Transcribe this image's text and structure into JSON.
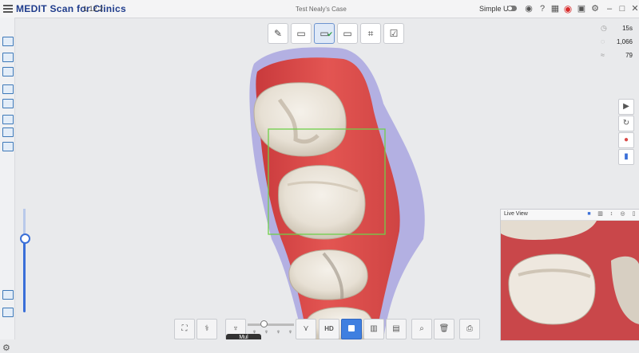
{
  "app": {
    "name_main": "MEDIT",
    "name_sub": "Scan for Clinics",
    "version": "1.12.2",
    "case_title": "Test Nealy's Case",
    "simple_ui_label": "Simple UI",
    "simple_ui_enabled": true
  },
  "titlebar_icons": [
    "hamburger-icon",
    "toggle-icon",
    "camera-icon",
    "help-icon",
    "keyboard-icon",
    "record-icon",
    "screenshot-icon",
    "settings-icon",
    "minimize-icon",
    "maximize-icon",
    "close-icon"
  ],
  "step_bar": {
    "steps": [
      {
        "name": "prescription",
        "icon": "✎"
      },
      {
        "name": "maxilla",
        "icon": "▭"
      },
      {
        "name": "mandible",
        "icon": "▭",
        "active": true,
        "done": true
      },
      {
        "name": "occlusion",
        "icon": "▭"
      },
      {
        "name": "align",
        "icon": "⌗"
      },
      {
        "name": "review",
        "icon": "☑"
      }
    ]
  },
  "stats": {
    "time": "15s",
    "count": "1,066",
    "rate": "79"
  },
  "live_view": {
    "title": "Live View"
  },
  "bottom_tooltip": "Mul",
  "colors": {
    "accent": "#3a6fd8",
    "tissue": "#d94a48",
    "tooth": "#efe9df",
    "scan_box": "#6fd04a",
    "record": "#d92b2b"
  }
}
